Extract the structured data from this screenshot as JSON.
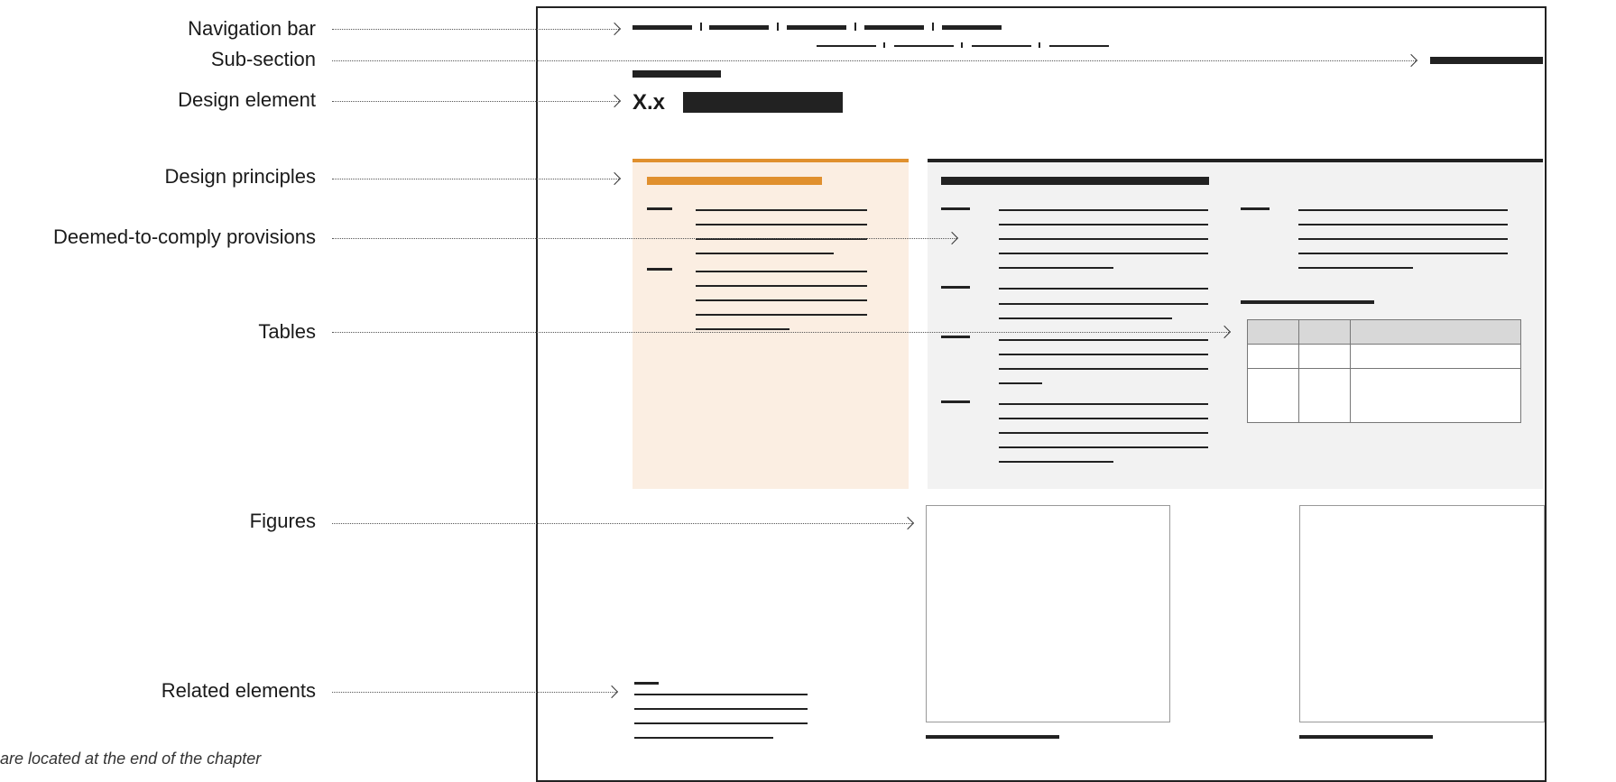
{
  "labels": {
    "navigation_bar": "Navigation bar",
    "sub_section": "Sub-section",
    "design_element": "Design element",
    "design_principles": "Design principles",
    "deemed_to_comply": "Deemed-to-comply provisions",
    "tables": "Tables",
    "figures": "Figures",
    "related_elements": "Related elements"
  },
  "page": {
    "element_number": "X.x"
  },
  "footnote": "are located at the end of the chapter",
  "colors": {
    "accent": "#e0902e",
    "accent_bg": "#fbeee2",
    "dtc_bg": "#f2f2f2",
    "ink": "#222222"
  }
}
